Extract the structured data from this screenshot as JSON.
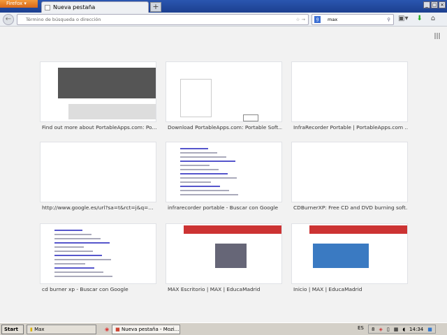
{
  "window": {
    "firefox_button": "Firefox",
    "tab_title": "Nueva pestaña",
    "new_tab": "+"
  },
  "navbar": {
    "url_placeholder": "Término de búsqueda o dirección",
    "search_engine": "Google",
    "search_value": "max"
  },
  "tiles": [
    {
      "label": "Find out more about PortableApps.com: Po..."
    },
    {
      "label": "Download PortableApps.com: Portable Soft..."
    },
    {
      "label": "InfraRecorder Portable | PortableApps.com ..."
    },
    {
      "label": "http://www.google.es/url?sa=t&rct=j&q=..."
    },
    {
      "label": "infrarecorder portable - Buscar con Google"
    },
    {
      "label": "CDBurnerXP: Free CD and DVD burning soft..."
    },
    {
      "label": "cd burner xp - Buscar con Google"
    },
    {
      "label": "MAX Escritorio | MAX | EducaMadrid"
    },
    {
      "label": "Inicio | MAX | EducaMadrid"
    }
  ],
  "taskbar": {
    "start": "Start",
    "folder": "Max",
    "active_window": "Nueva pestaña - Mozi...",
    "lang": "ES",
    "clock": "14:34"
  }
}
